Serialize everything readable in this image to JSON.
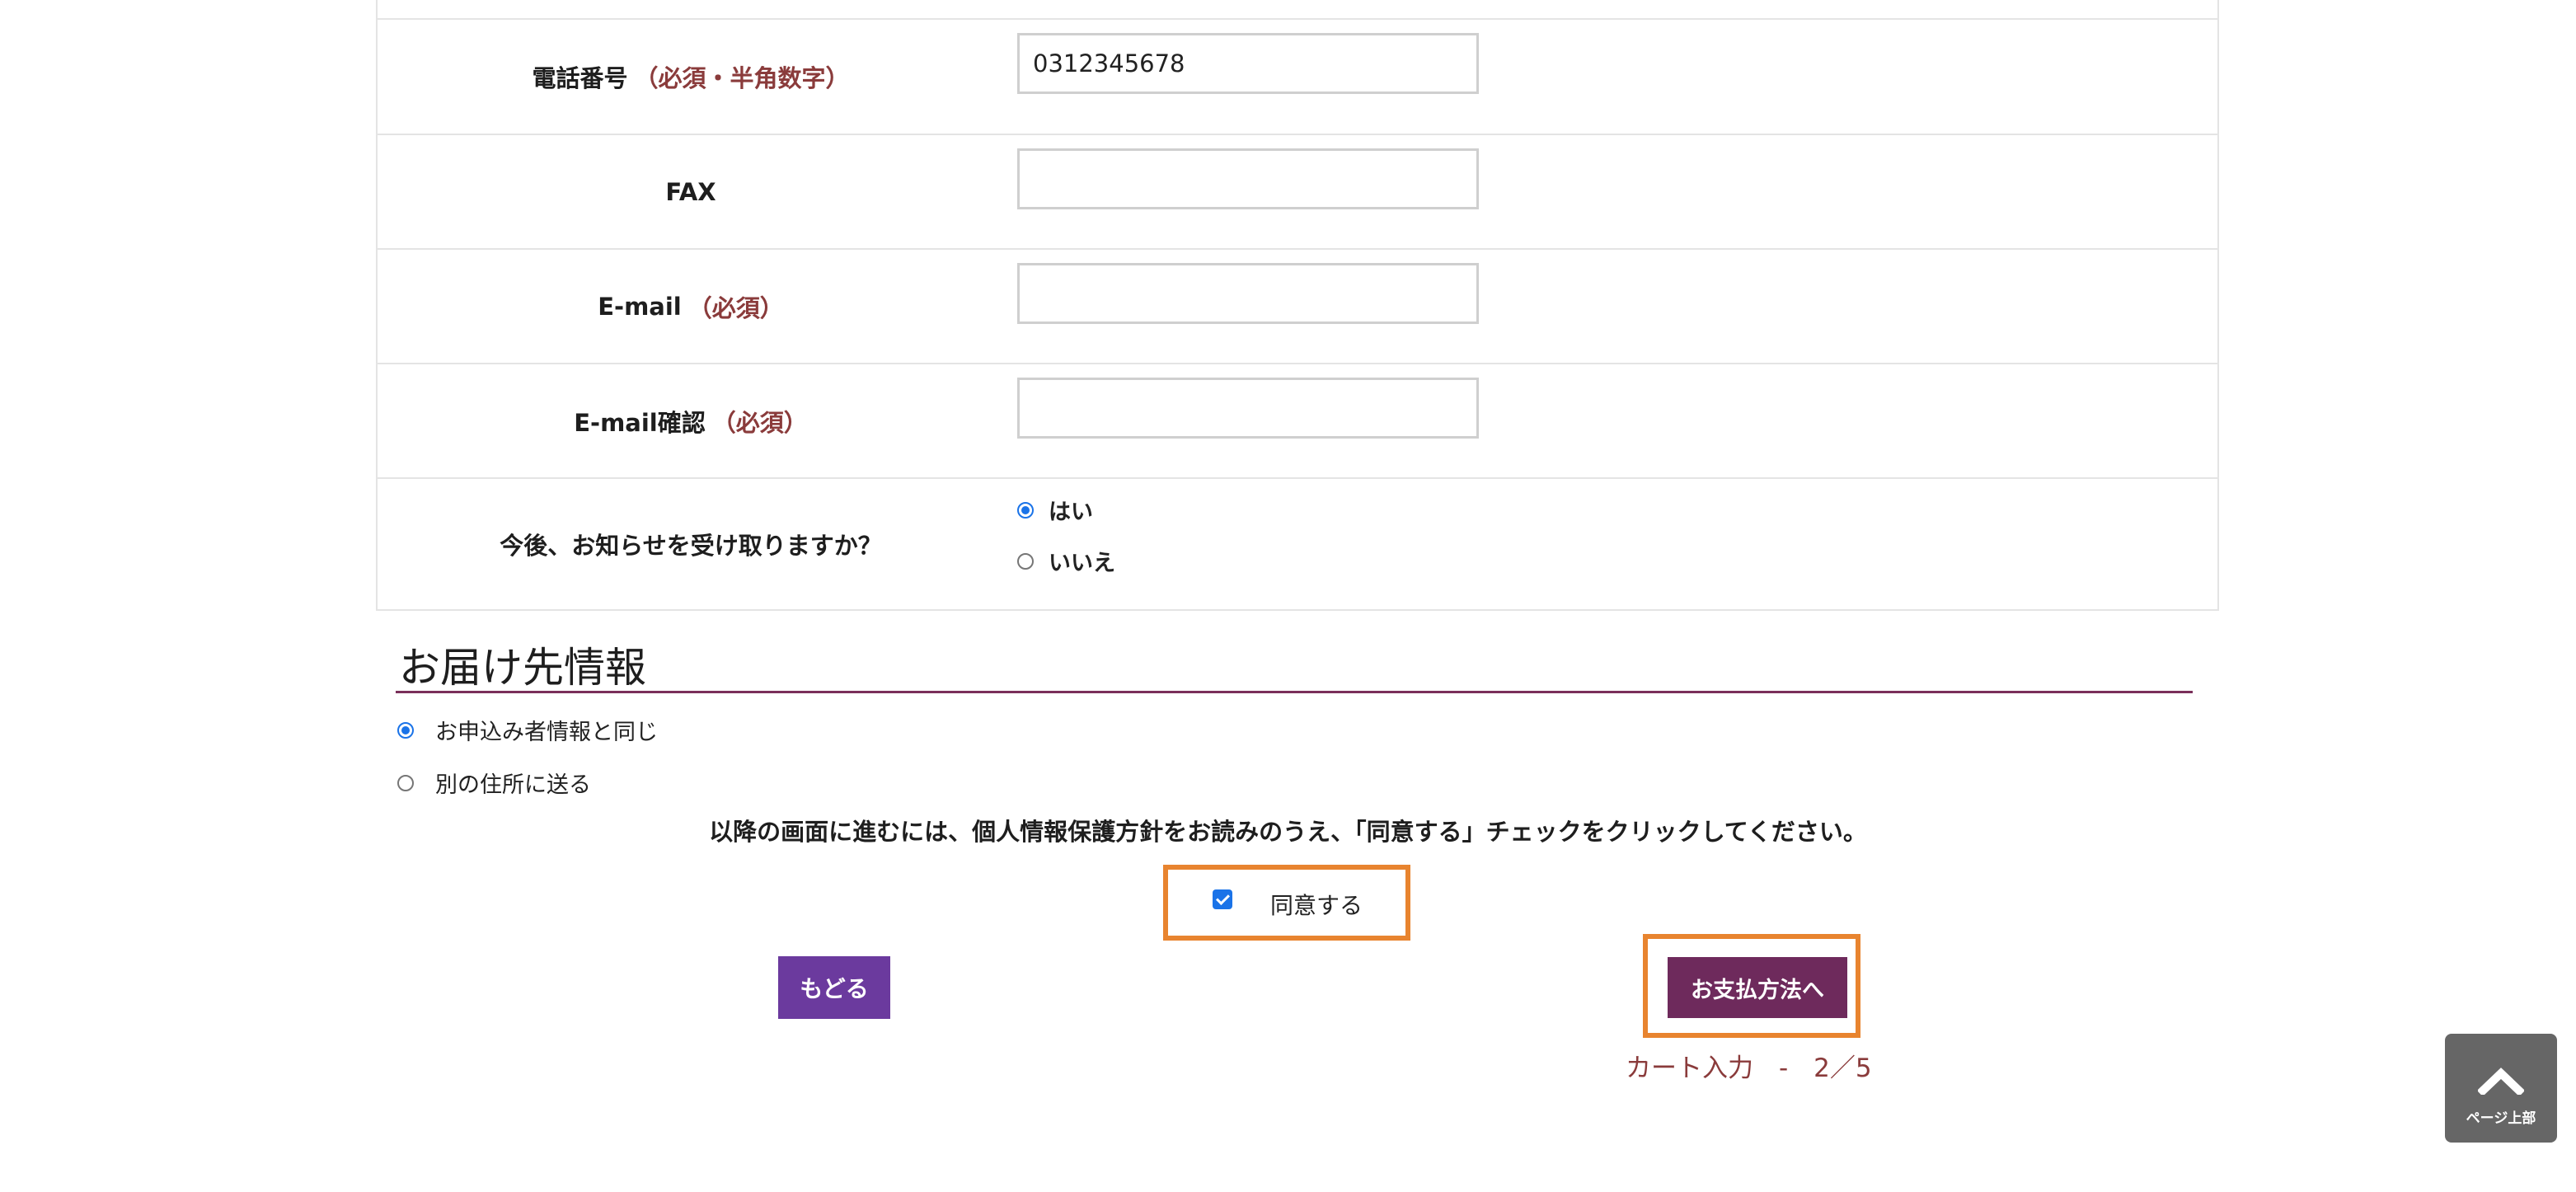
{
  "form": {
    "phone": {
      "label": "電話番号",
      "note": "（必須・半角数字）",
      "value": "0312345678"
    },
    "fax": {
      "label": "FAX",
      "value": ""
    },
    "email": {
      "label": "E-mail",
      "note": "（必須）",
      "value": ""
    },
    "email_confirm": {
      "label": "E-mail確認",
      "note": "（必須）",
      "value": ""
    },
    "newsletter": {
      "label": "今後、お知らせを受け取りますか？",
      "options": [
        {
          "label": "はい",
          "checked": true
        },
        {
          "label": "いいえ",
          "checked": false
        }
      ]
    }
  },
  "delivery": {
    "title": "お届け先情報",
    "options": [
      {
        "label": "お申込み者情報と同じ",
        "checked": true
      },
      {
        "label": "別の住所に送る",
        "checked": false
      }
    ]
  },
  "notice": "以降の画面に進むには、個人情報保護方針をお読みのうえ、「同意する」チェックをクリックしてください。",
  "agree": {
    "label": "同意する",
    "checked": true
  },
  "buttons": {
    "back": "もどる",
    "next": "お支払方法へ"
  },
  "step": "カート入力　-　2／5",
  "page_top": {
    "label": "ページ上部",
    "icon": "chevron-up-icon"
  },
  "colors": {
    "required_note": "#8a3b3b",
    "back_button": "#6b3a9e",
    "next_button": "#6e2a5c",
    "highlight": "#e8842f",
    "section_rule": "#7a2f5a",
    "radio_checked": "#1a73e8"
  }
}
